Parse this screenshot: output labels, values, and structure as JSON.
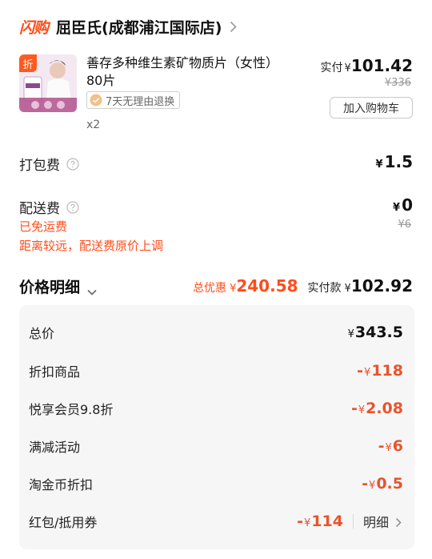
{
  "store": {
    "flash_logo": "闪购",
    "name": "屈臣氏(成都浦江国际店)"
  },
  "product": {
    "discount_tag": "折",
    "title": "善存多种维生素矿物质片（女性）80片",
    "return_policy": "7天无理由退换",
    "quantity": "x2",
    "paid_label": "实付",
    "currency": "¥",
    "paid_amount": "101.42",
    "original_price": "¥336",
    "add_cart_label": "加入购物车"
  },
  "packing_fee": {
    "label": "打包费",
    "currency": "¥",
    "amount": "1.5"
  },
  "delivery_fee": {
    "label": "配送费",
    "currency": "¥",
    "amount": "0",
    "original": "¥6",
    "free_note": "已免运费",
    "distance_note": "距离较远，配送费原价上调"
  },
  "price_detail": {
    "title": "价格明细",
    "discount_label": "总优惠",
    "discount_currency": "¥",
    "discount_amount": "240.58",
    "paid_label": "实付款",
    "paid_currency": "¥",
    "paid_amount": "102.92"
  },
  "breakdown": [
    {
      "label": "总价",
      "sign": "",
      "currency": "¥",
      "amount": "343.5"
    },
    {
      "label": "折扣商品",
      "sign": "-",
      "currency": "¥",
      "amount": "118"
    },
    {
      "label": "悦享会员9.8折",
      "sign": "-",
      "currency": "¥",
      "amount": "2.08"
    },
    {
      "label": "满减活动",
      "sign": "-",
      "currency": "¥",
      "amount": "6"
    },
    {
      "label": "淘金币折扣",
      "sign": "-",
      "currency": "¥",
      "amount": "0.5"
    },
    {
      "label": "红包/抵用券",
      "sign": "-",
      "currency": "¥",
      "amount": "114",
      "detail_link": "明细"
    }
  ],
  "colors": {
    "accent_orange": "#ff4d1a",
    "discount_red": "#e8542c",
    "breakdown_bg": "#f6f6f7"
  }
}
